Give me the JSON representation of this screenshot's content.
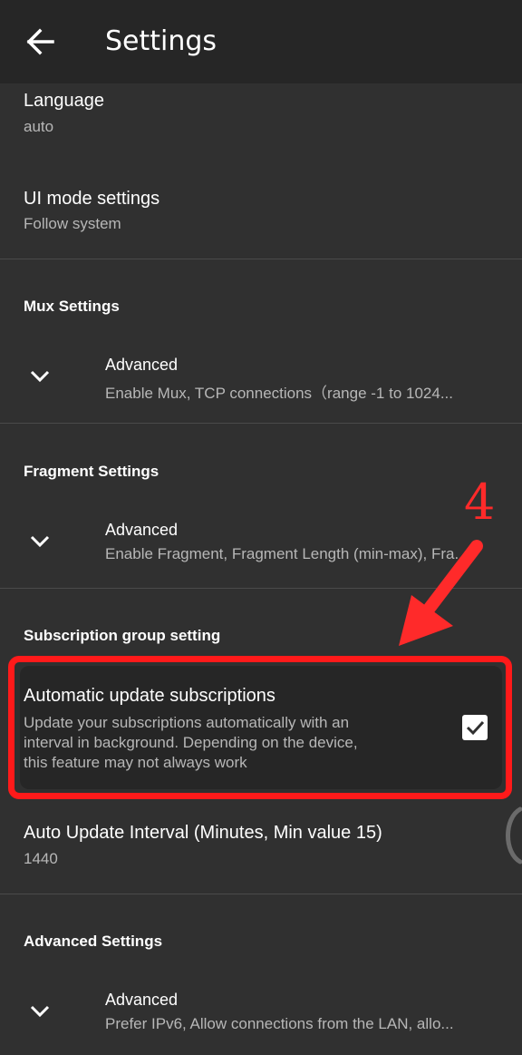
{
  "appbar": {
    "title": "Settings",
    "back_icon": "arrow-back-icon"
  },
  "general": {
    "language": {
      "title": "Language",
      "value": "auto"
    },
    "ui_mode": {
      "title": "UI mode settings",
      "value": "Follow system"
    }
  },
  "mux": {
    "category": "Mux Settings",
    "advanced_title": "Advanced",
    "advanced_summary": "Enable Mux, TCP connections（range -1 to 1024..."
  },
  "fragment": {
    "category": "Fragment Settings",
    "advanced_title": "Advanced",
    "advanced_summary": "Enable Fragment, Fragment Length (min-max), Fra..."
  },
  "subscription": {
    "category": "Subscription group setting",
    "auto_update": {
      "title": "Automatic update subscriptions",
      "summary_lines": [
        "Update your subscriptions automatically with an",
        "interval in background. Depending on the device,",
        "this feature may not always work"
      ],
      "checked": true
    },
    "interval": {
      "title": "Auto Update Interval (Minutes, Min value 15)",
      "value": "1440"
    }
  },
  "advanced": {
    "category": "Advanced Settings",
    "advanced_title": "Advanced",
    "advanced_summary": "Prefer IPv6, Allow connections from the LAN, allo..."
  },
  "annotation": {
    "step_number": "4",
    "color": "#ff1a1a"
  }
}
